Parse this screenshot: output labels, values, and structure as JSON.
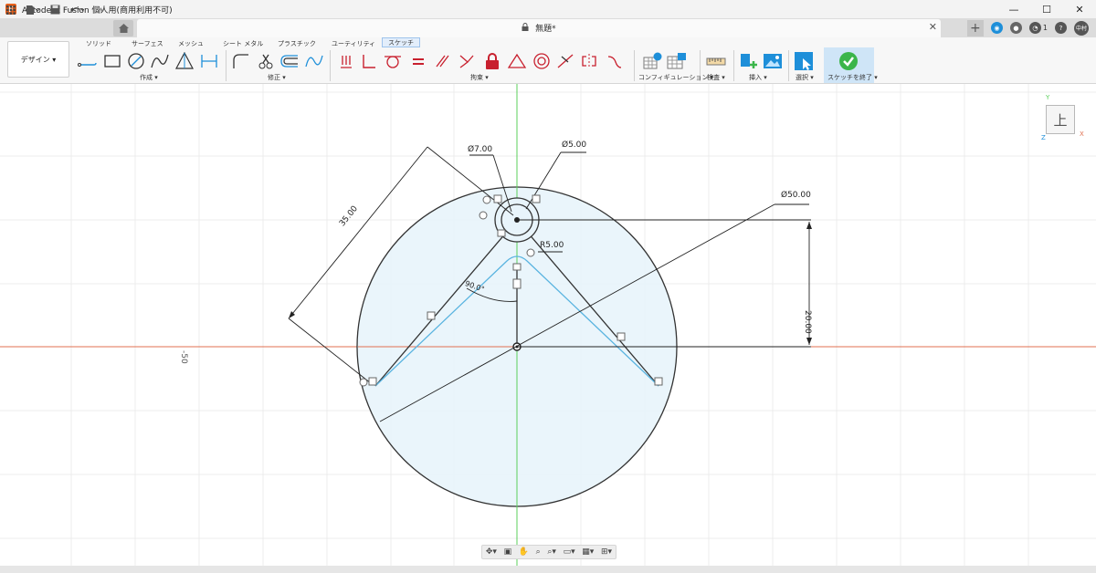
{
  "window": {
    "title": "Autodesk Fusion 個人用(商用利用不可)",
    "app_icon": "F",
    "minimize": "—",
    "maximize": "☐",
    "close": "✕"
  },
  "document": {
    "tab_title": "無題*",
    "tab_close": "✕",
    "user_initials": "中村",
    "job_count": "1"
  },
  "ribbon": {
    "workspace_label": "デザイン ▾",
    "tabs": [
      "ソリッド",
      "サーフェス",
      "メッシュ",
      "シート メタル",
      "プラスチック",
      "ユーティリティ",
      "スケッチ"
    ],
    "active_tab": "スケッチ",
    "groups": {
      "create": "作成 ▾",
      "modify": "修正 ▾",
      "constraints": "拘束 ▾",
      "configuration": "コンフィギュレーション ▾",
      "inspect": "検査 ▾",
      "insert": "挿入 ▾",
      "select": "選択 ▾",
      "finish": "スケッチを終了 ▾"
    }
  },
  "sketch": {
    "dimensions": {
      "dia_outer": "Ø50.00",
      "dia_hole_large": "Ø7.00",
      "dia_hole_small": "Ø5.00",
      "radius": "R5.00",
      "length": "35.00",
      "vertical": "20.00",
      "angle": "90.0°"
    },
    "axis_label": "-50"
  },
  "viewcube": {
    "face": "上",
    "axis_x": "X",
    "axis_y": "Y",
    "axis_z": "Z"
  },
  "colors": {
    "accent": "#1e8fd9",
    "finish_check": "#3bb54a",
    "axis_x": "#e07050",
    "axis_y": "#5bcf5b",
    "sketch_fill": "#e8f4fb",
    "construction": "#5ab4e0"
  }
}
